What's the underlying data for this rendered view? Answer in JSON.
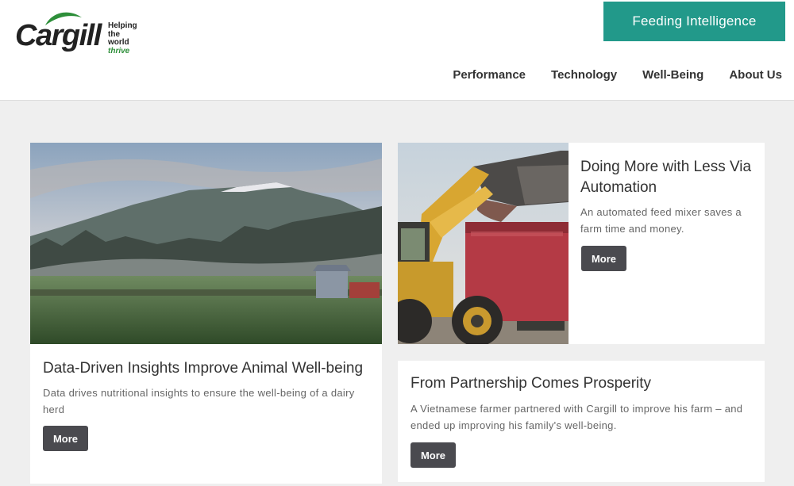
{
  "brand": {
    "name": "Cargill",
    "tagline_line1": "Helping",
    "tagline_line2": "the world",
    "tagline_line3": "thrive",
    "accent_color": "#22998a",
    "logo_green": "#2e8f3a"
  },
  "header": {
    "cta_label": "Feeding Intelligence",
    "nav": [
      {
        "label": "Performance"
      },
      {
        "label": "Technology"
      },
      {
        "label": "Well-Being"
      },
      {
        "label": "About Us"
      }
    ]
  },
  "articles": [
    {
      "title": "Data-Driven Insights Improve Animal Well-being",
      "summary": "Data drives nutritional insights to ensure the well-being of a dairy herd",
      "button": "More",
      "image": "dairy-farm-mountain-photo"
    },
    {
      "title": "Doing More with Less Via Automation",
      "summary": "An automated feed mixer saves a farm time and money.",
      "button": "More",
      "image": "loader-feed-mixer-photo"
    },
    {
      "title": "From Partnership Comes Prosperity",
      "summary": "A Vietnamese farmer partnered with Cargill to improve his farm – and ended up improving his family's well-being.",
      "button": "More"
    }
  ]
}
